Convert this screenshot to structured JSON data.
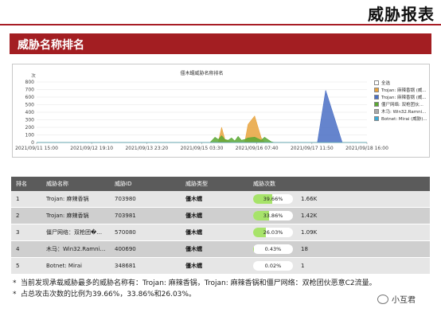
{
  "header": {
    "title": "威胁报表"
  },
  "section": {
    "title": "威胁名称排名"
  },
  "chart_data": {
    "type": "area",
    "title": "僵木蠕威胁名称排名",
    "y_unit": "次",
    "ylim": [
      0,
      800
    ],
    "yticks": [
      0,
      100,
      200,
      300,
      400,
      500,
      600,
      700,
      800
    ],
    "x_tick_labels": [
      "2021/09/11 15:00",
      "2021/09/12 19:10",
      "2021/09/13 23:20",
      "2021/09/15 03:30",
      "2021/09/16 07:40",
      "2021/09/17 11:50",
      "2021/09/18 16:00"
    ],
    "x": [
      0,
      0.8,
      0.85,
      0.87,
      0.88,
      0.9,
      0.92,
      0.94,
      0.96,
      0.99,
      1.05,
      1.08,
      1.1,
      1.12,
      1.14,
      1.16,
      1.18,
      1.2,
      1.22,
      1.24,
      1.26,
      1.28,
      1.32,
      1.36,
      1.38,
      1.4,
      1.42,
      1.44,
      1.46,
      1.5,
      1.55,
      1.6,
      1.65,
      1.7,
      1.75,
      1.85,
      2.0
    ],
    "series": [
      {
        "name": "Trojan: 麻辣香锅 (威...",
        "color": "#e8a33d",
        "values": [
          0,
          0,
          0,
          0,
          0,
          0,
          0,
          0,
          0,
          0,
          0,
          0,
          0,
          200,
          40,
          20,
          0,
          0,
          0,
          0,
          0,
          240,
          350,
          60,
          0,
          0,
          0,
          0,
          0,
          0,
          0,
          0,
          0,
          0,
          0,
          0,
          0
        ]
      },
      {
        "name": "Trojan: 麻辣香锅 (威...",
        "color": "#4a6fc4",
        "values": [
          0,
          0,
          0,
          0,
          0,
          0,
          0,
          0,
          0,
          0,
          0,
          0,
          0,
          0,
          0,
          0,
          0,
          0,
          0,
          0,
          0,
          0,
          0,
          0,
          0,
          0,
          0,
          0,
          0,
          0,
          0,
          0,
          0,
          0,
          690,
          0,
          0
        ]
      },
      {
        "name": "僵尸网络: 双枪团伙...",
        "color": "#5aa832",
        "values": [
          0,
          0,
          0,
          0,
          0,
          0,
          0,
          0,
          0,
          0,
          0,
          70,
          40,
          90,
          40,
          30,
          60,
          20,
          80,
          30,
          40,
          60,
          70,
          30,
          70,
          40,
          10,
          0,
          0,
          0,
          0,
          0,
          0,
          0,
          0,
          0,
          0
        ]
      },
      {
        "name": "木马: Win32.Ramni...",
        "color": "#a9a9a9",
        "values": [
          0,
          0,
          0,
          0,
          0,
          0,
          0,
          0,
          0,
          0,
          0,
          0,
          0,
          0,
          0,
          0,
          0,
          0,
          0,
          0,
          0,
          0,
          0,
          0,
          0,
          0,
          0,
          0,
          0,
          0,
          0,
          0,
          0,
          0,
          0,
          0,
          0
        ]
      },
      {
        "name": "Botnet: Mirai (威胁)...",
        "color": "#3aaad6",
        "values": [
          0,
          0,
          0,
          0,
          0,
          0,
          0,
          0,
          0,
          0,
          0,
          0,
          0,
          0,
          0,
          0,
          0,
          0,
          0,
          0,
          0,
          0,
          0,
          0,
          0,
          0,
          0,
          0,
          0,
          0,
          0,
          0,
          0,
          0,
          0,
          0,
          0
        ]
      }
    ],
    "legend": {
      "all_label": "全选",
      "items": [
        {
          "label": "Trojan: 麻辣香锅 (威...",
          "color": "#e8a33d"
        },
        {
          "label": "Trojan: 麻辣香锅 (威...",
          "color": "#4a6fc4"
        },
        {
          "label": "僵尸网络: 双枪团伙...",
          "color": "#5aa832"
        },
        {
          "label": "木马: Win32.Ramni...",
          "color": "#a9a9a9"
        },
        {
          "label": "Botnet: Mirai (威胁)...",
          "color": "#3aaad6"
        }
      ]
    }
  },
  "table": {
    "headers": [
      "排名",
      "威胁名称",
      "威胁ID",
      "威胁类型",
      "威胁次数"
    ],
    "rows": [
      {
        "rank": "1",
        "name": "Trojan: 麻辣香锅",
        "id": "703980",
        "type": "僵木蠕",
        "pct_text": "39.66%",
        "pct": 0.3966,
        "count": "1.66K"
      },
      {
        "rank": "2",
        "name": "Trojan: 麻辣香锅",
        "id": "703981",
        "type": "僵木蠕",
        "pct_text": "33.86%",
        "pct": 0.3386,
        "count": "1.42K"
      },
      {
        "rank": "3",
        "name": "僵尸网络：双枪团�…",
        "id": "570080",
        "type": "僵木蠕",
        "pct_text": "26.03%",
        "pct": 0.2603,
        "count": "1.09K"
      },
      {
        "rank": "4",
        "name": "木马：Win32.Ramni…",
        "id": "400690",
        "type": "僵木蠕",
        "pct_text": "0.43%",
        "pct": 0.0043,
        "count": "18"
      },
      {
        "rank": "5",
        "name": "Botnet: Mirai",
        "id": "348681",
        "type": "僵木蠕",
        "pct_text": "0.02%",
        "pct": 0.0002,
        "count": "1"
      }
    ]
  },
  "notes": [
    "当前发现承载威胁最多的威胁名称有：Trojan: 麻辣香锅，Trojan: 麻辣香锅和僵尸网络：双枪团伙恶意C2流量。",
    "占总攻击次数的比例为39.66%，33.86%和26.03%。"
  ],
  "watermark": {
    "text": "小互君"
  }
}
